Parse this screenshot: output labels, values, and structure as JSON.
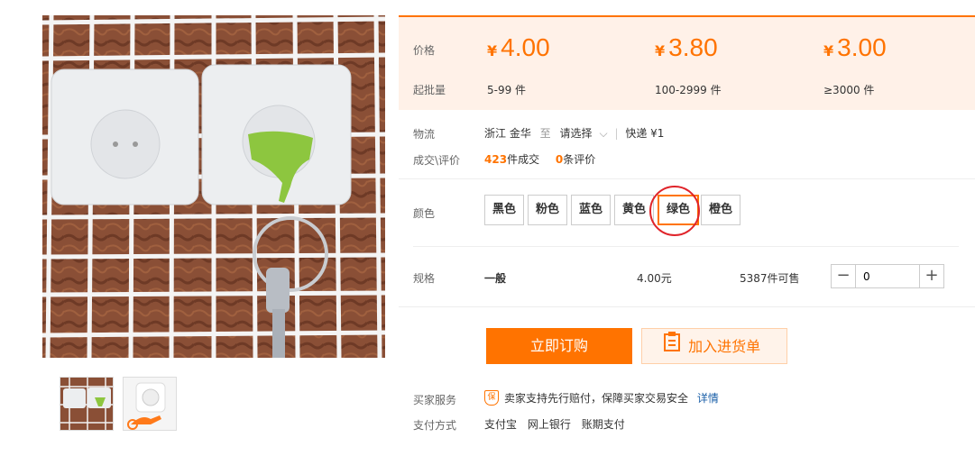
{
  "price_section": {
    "price_label": "价格",
    "moq_label": "起批量",
    "currency": "¥",
    "tiers": [
      {
        "price": "4.00",
        "range": "5-99 件"
      },
      {
        "price": "3.80",
        "range": "100-2999 件"
      },
      {
        "price": "3.00",
        "range": "≥3000 件"
      }
    ]
  },
  "logistics": {
    "label": "物流",
    "origin": "浙江 金华",
    "to": "至",
    "destination": "请选择",
    "shipping": "快递 ¥1"
  },
  "deals": {
    "label": "成交\\评价",
    "sold_count": "423",
    "sold_suffix": "件成交",
    "review_count": "0",
    "review_suffix": "条评价"
  },
  "color": {
    "label": "颜色",
    "options": [
      "黑色",
      "粉色",
      "蓝色",
      "黄色",
      "绿色",
      "橙色"
    ],
    "selected": "绿色"
  },
  "spec": {
    "label": "规格",
    "name": "一般",
    "price": "4.00元",
    "stock": "5387件可售",
    "quantity": "0",
    "minus": "−",
    "plus": "+"
  },
  "actions": {
    "order_label": "立即订购",
    "cart_label": "加入进货单"
  },
  "service": {
    "label": "买家服务",
    "badge": "保",
    "text": "卖家支持先行赔付，保障买家交易安全",
    "link": "详情"
  },
  "payment": {
    "label": "支付方式",
    "methods": [
      "支付宝",
      "网上银行",
      "账期支付"
    ]
  },
  "colors": {
    "accent": "#ff7300",
    "price_bg": "#fff1e8",
    "link": "#1a5fa8",
    "annotation": "#e0242a"
  }
}
